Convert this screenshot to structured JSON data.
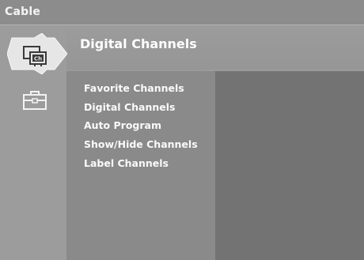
{
  "window": {
    "title": "Cable"
  },
  "header": {
    "title": "Digital Channels"
  },
  "icons": [
    {
      "name": "channels-icon"
    },
    {
      "name": "setup-icon"
    }
  ],
  "menu": {
    "items": [
      {
        "label": "Favorite Channels"
      },
      {
        "label": "Digital Channels"
      },
      {
        "label": "Auto Program"
      },
      {
        "label": "Show/Hide Channels"
      },
      {
        "label": "Label Channels"
      }
    ]
  },
  "colors": {
    "background": "#9a9a9a",
    "menu_panel": "#8a8a8a",
    "content_panel": "#737373",
    "text": "#ffffff"
  }
}
